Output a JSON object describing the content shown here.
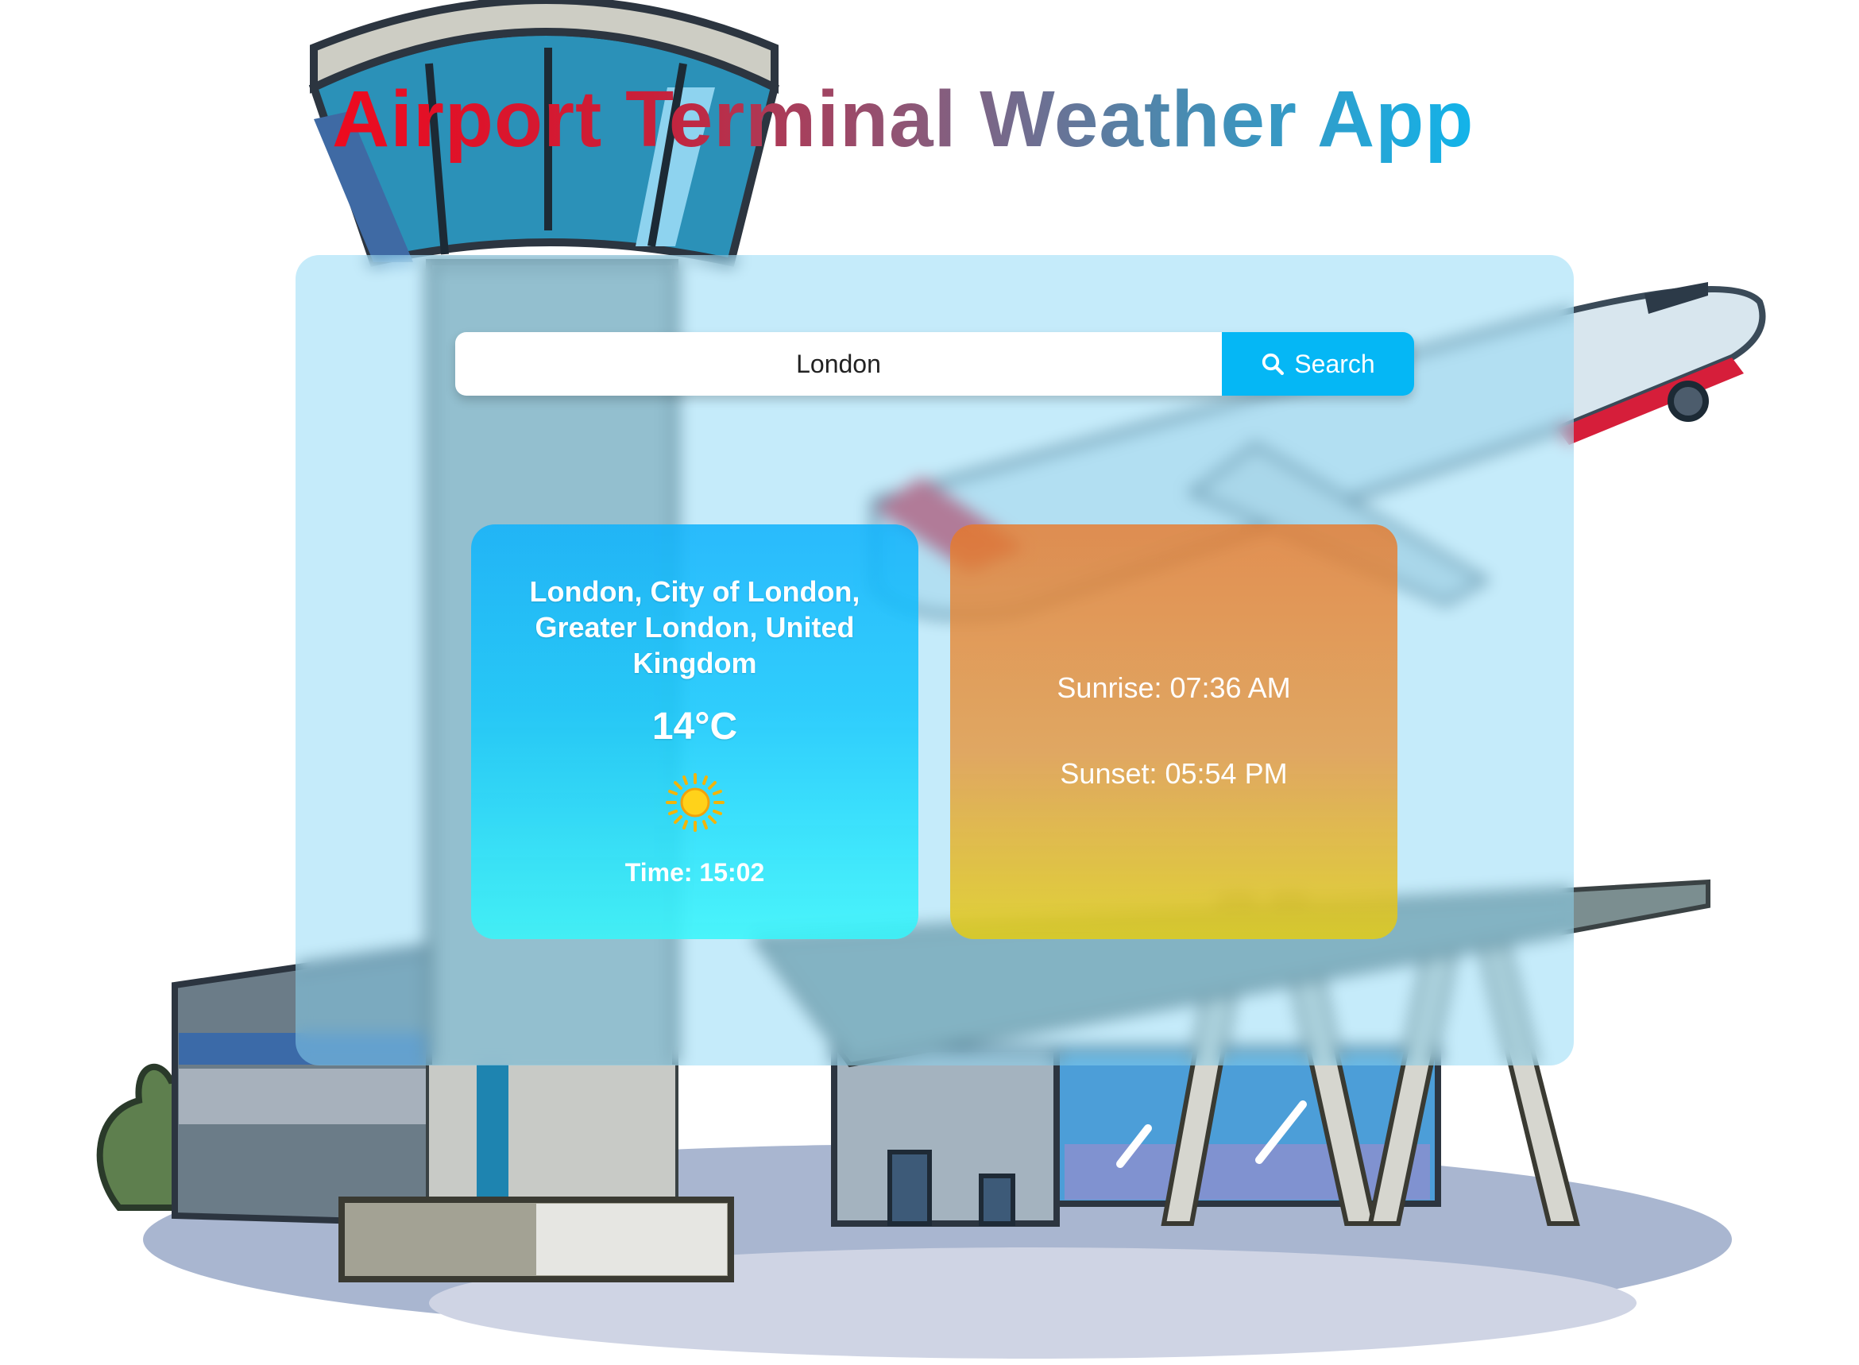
{
  "app": {
    "title": "Airport Terminal Weather App"
  },
  "search": {
    "value": "London",
    "button_label": "Search"
  },
  "weather": {
    "location": "London, City of London, Greater London, United Kingdom",
    "temperature": "14°C",
    "condition_icon": "sun-icon",
    "time": "Time: 15:02"
  },
  "sun": {
    "sunrise": "Sunrise: 07:36 AM",
    "sunset": "Sunset: 05:54 PM"
  },
  "colors": {
    "title_start": "#ee0a1e",
    "title_end": "#12b4ea",
    "search_button": "#05b7f5",
    "weather_card": "#1ec0fb",
    "sun_card": "#e59046"
  }
}
